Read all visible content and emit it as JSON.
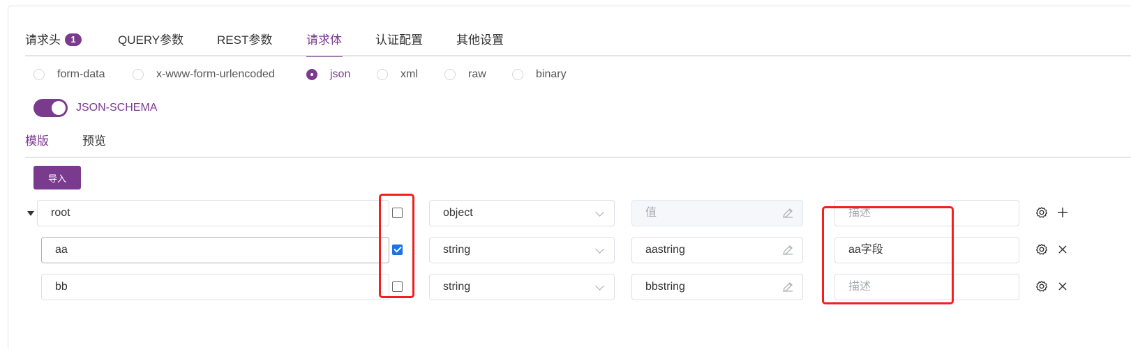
{
  "tabs": [
    {
      "label": "请求头",
      "badge": "1"
    },
    {
      "label": "QUERY参数"
    },
    {
      "label": "REST参数"
    },
    {
      "label": "请求体"
    },
    {
      "label": "认证配置"
    },
    {
      "label": "其他设置"
    }
  ],
  "body_types": [
    "form-data",
    "x-www-form-urlencoded",
    "json",
    "xml",
    "raw",
    "binary"
  ],
  "selected_body_type": "json",
  "json_schema_label": "JSON-SCHEMA",
  "subtabs": [
    "模版",
    "预览"
  ],
  "import_label": "导入",
  "rows": [
    {
      "name": "root",
      "required": false,
      "type": "object",
      "value": "",
      "value_placeholder": "值",
      "description": "",
      "description_placeholder": "描述",
      "action": "add"
    },
    {
      "name": "aa",
      "required": true,
      "type": "string",
      "value": "aastring",
      "value_placeholder": "",
      "description": "aa字段",
      "description_placeholder": "描述",
      "action": "remove"
    },
    {
      "name": "bb",
      "required": false,
      "type": "string",
      "value": "bbstring",
      "value_placeholder": "",
      "description": "",
      "description_placeholder": "描述",
      "action": "remove"
    }
  ],
  "colors": {
    "accent": "#7a3b8f",
    "highlight": "#f0201f",
    "checkbox": "#1a73e8"
  }
}
